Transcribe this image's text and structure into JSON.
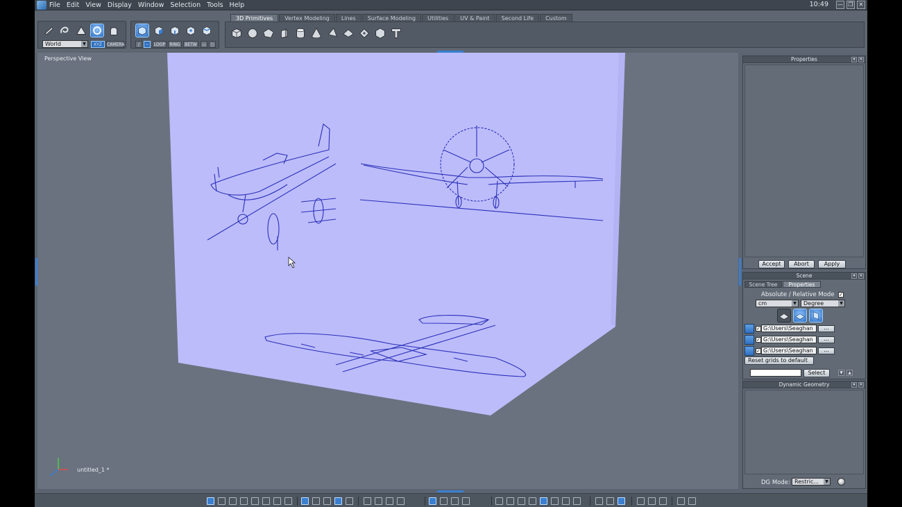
{
  "app": {
    "menu": [
      "File",
      "Edit",
      "View",
      "Display",
      "Window",
      "Selection",
      "Tools",
      "Help"
    ],
    "clock": "10:49",
    "window_controls": {
      "minimize": "—",
      "maximize": "❐",
      "close": "✕"
    }
  },
  "toolbar": {
    "coord_system": {
      "value": "World",
      "options": [
        "World"
      ]
    },
    "small_buttons": [
      "XYZ",
      "CAMERA"
    ],
    "select_modes": [
      "LOOP",
      "RING",
      "BETW"
    ],
    "tabs": [
      {
        "label": "3D Primitives",
        "active": true
      },
      {
        "label": "Vertex Modeling",
        "active": false
      },
      {
        "label": "Lines",
        "active": false
      },
      {
        "label": "Surface Modeling",
        "active": false
      },
      {
        "label": "Utilities",
        "active": false
      },
      {
        "label": "UV & Paint",
        "active": false
      },
      {
        "label": "Second Life",
        "active": false
      },
      {
        "label": "Custom",
        "active": false
      }
    ],
    "primitive_icons": [
      "cube-icon",
      "sphere-icon",
      "plane-icon",
      "grid-box-icon",
      "cylinder-icon",
      "cone-icon",
      "pyramid-icon",
      "disc-icon",
      "torus-icon",
      "geosphere-icon",
      "text-icon"
    ]
  },
  "viewport": {
    "title": "Perspective View",
    "object_name": "untitled_1 *",
    "colors": {
      "background": "#6a727f",
      "blueprint_plane": "#bcbcfb",
      "blueprint_ink": "#2a2fb8"
    }
  },
  "properties_panel": {
    "title": "Properties",
    "buttons": {
      "accept": "Accept",
      "abort": "Abort",
      "apply": "Apply"
    }
  },
  "scene_panel": {
    "title": "Scene",
    "tabs": [
      {
        "label": "Scene Tree",
        "active": false
      },
      {
        "label": "Properties",
        "active": true
      }
    ],
    "mode_label": "Absolute / Relative Mode",
    "mode_checked": true,
    "unit": "cm",
    "angle_unit": "Degree",
    "grid_paths": [
      {
        "path": "G:\\Users\\Seaghan",
        "checked": true,
        "browse": "..."
      },
      {
        "path": "G:\\Users\\Seaghan",
        "checked": true,
        "browse": "..."
      },
      {
        "path": "G:\\Users\\Seaghan",
        "checked": true,
        "browse": "..."
      }
    ],
    "reset_button": "Reset grids to default",
    "select_input_value": "",
    "select_button": "Select"
  },
  "dynamic_geometry_panel": {
    "title": "Dynamic Geometry",
    "dg_mode_label": "DG Mode:",
    "dg_mode_value": "Restric..."
  }
}
